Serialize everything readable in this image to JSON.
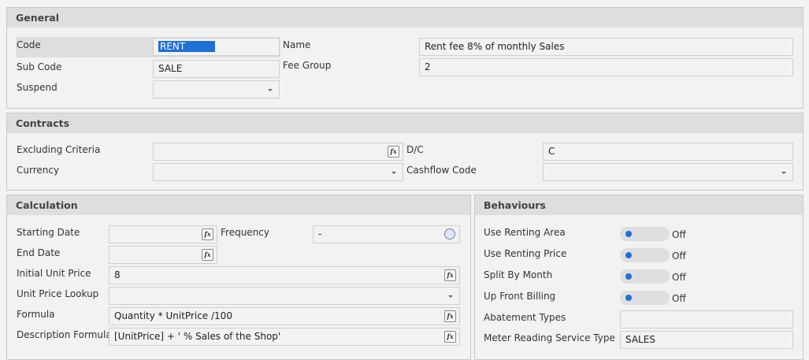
{
  "general": {
    "title": "General",
    "code_label": "Code",
    "code_value": "RENT",
    "name_label": "Name",
    "name_value": "Rent fee 8% of monthly Sales",
    "subcode_label": "Sub Code",
    "subcode_value": "SALE",
    "feegroup_label": "Fee Group",
    "feegroup_value": "2",
    "suspend_label": "Suspend"
  },
  "contracts": {
    "title": "Contracts",
    "excluding_label": "Excluding Criteria",
    "dc_label": "D/C",
    "dc_value": "C",
    "currency_label": "Currency",
    "cashflow_label": "Cashflow Code"
  },
  "calculation": {
    "title": "Calculation",
    "starting_label": "Starting Date",
    "frequency_label": "Frequency",
    "frequency_value": "-",
    "end_label": "End Date",
    "iup_label": "Initial Unit Price",
    "iup_value": "8",
    "upl_label": "Unit Price Lookup",
    "formula_label": "Formula",
    "formula_value": "Quantity * UnitPrice /100",
    "desc_label": "Description Formula",
    "desc_value": "[UnitPrice] + ' % Sales of the Shop'"
  },
  "behaviours": {
    "title": "Behaviours",
    "toggles": [
      {
        "label": "Use Renting Area",
        "state": "Off"
      },
      {
        "label": "Use Renting Price",
        "state": "Off"
      },
      {
        "label": "Split By Month",
        "state": "Off"
      },
      {
        "label": "Up Front Billing",
        "state": "Off"
      }
    ],
    "abatement_label": "Abatement Types",
    "meter_label": "Meter Reading Service Type",
    "meter_value": "SALES"
  },
  "fx_icon": "fx"
}
